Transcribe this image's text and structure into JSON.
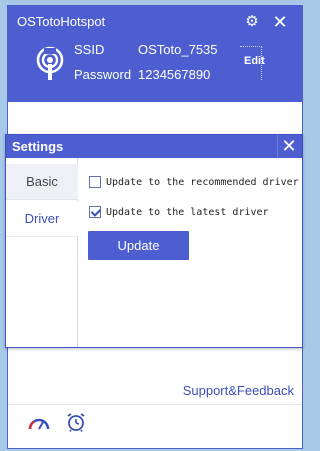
{
  "app": {
    "title": "OSTotoHotspot",
    "ssid_label": "SSID",
    "ssid_value": "OSToto_7535",
    "password_label": "Password",
    "password_value": "1234567890",
    "edit_label": "Edit",
    "support_link": "Support&Feedback"
  },
  "dialog": {
    "title": "Settings",
    "tabs": [
      {
        "label": "Basic"
      },
      {
        "label": "Driver"
      }
    ],
    "options": [
      {
        "label": "Update to the recommended driver",
        "checked": false
      },
      {
        "label": "Update to the latest driver",
        "checked": true
      }
    ],
    "update_label": "Update"
  },
  "colors": {
    "accent": "#4d5fd0",
    "link": "#3a4fb8"
  }
}
